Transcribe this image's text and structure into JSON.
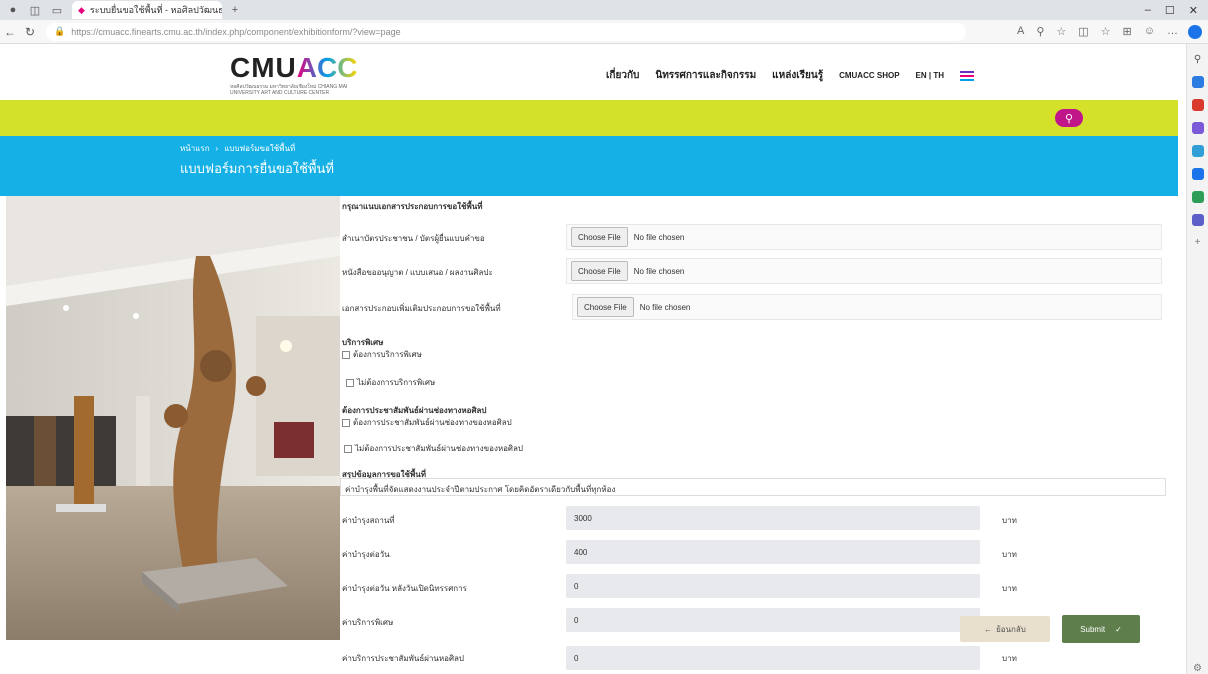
{
  "browser": {
    "tab_title": "ระบบยื่นขอใช้พื้นที่ - หอศิลปวัฒนธรรมฯ",
    "url": "https://cmuacc.finearts.cmu.ac.th/index.php/component/exhibitionform/?view=page",
    "win_min": "–",
    "win_max": "☐",
    "win_close": "✕"
  },
  "site": {
    "logo_main": "CMU",
    "logo_accent": "ACC",
    "logo_sub": "หอศิลปวัฒนธรรม มหาวิทยาลัยเชียงใหม่ CHIANG MAI UNIVERSITY ART AND CULTURE CENTER",
    "nav": [
      "เกี่ยวกับ",
      "นิทรรศการและกิจกรรม",
      "แหล่งเรียนรู้",
      "CMUACC SHOP",
      "EN | TH"
    ]
  },
  "breadcrumb": {
    "home": "หน้าแรก",
    "current": "แบบฟอร์มขอใช้พื้นที่"
  },
  "page_title": "แบบฟอร์มการยื่นขอใช้พื้นที่",
  "form": {
    "section_docs": "กรุณาแนบเอกสารประกอบการขอใช้พื้นที่",
    "file_rows": [
      {
        "label": "สำเนาบัตรประชาชน / บัตรผู้ยื่นแบบคำขอ",
        "button": "Choose File",
        "status": "No file chosen"
      },
      {
        "label": "หนังสือขออนุญาต / แบบเสนอ / ผลงานศิลปะ",
        "button": "Choose File",
        "status": "No file chosen"
      },
      {
        "label": "เอกสารประกอบเพิ่มเติมประกอบการขอใช้พื้นที่",
        "button": "Choose File",
        "status": "No file chosen"
      }
    ],
    "section_power": "บริการพิเศษ",
    "power_options": [
      "ต้องการบริการพิเศษ",
      "ไม่ต้องการบริการพิเศษ"
    ],
    "section_pr": "ต้องการประชาสัมพันธ์ผ่านช่องทางหอศิลป",
    "pr_options": [
      "ต้องการประชาสัมพันธ์ผ่านช่องทางของหอศิลป",
      "ไม่ต้องการประชาสัมพันธ์ผ่านช่องทางของหอศิลป"
    ],
    "section_summary": "สรุปข้อมูลการขอใช้พื้นที่",
    "summary_text": "ค่าบำรุงพื้นที่จัดแสดงงานประจำปีตามประกาศ โดยคิดอัตราเดียวกับพื้นที่ทุกห้อง",
    "fee_rows": [
      {
        "label": "ค่าบำรุงสถานที่",
        "value": "3000",
        "unit": "บาท"
      },
      {
        "label": "ค่าบำรุงต่อวัน",
        "value": "400",
        "unit": "บาท"
      },
      {
        "label": "ค่าบำรุงต่อวัน หลังวันเปิดนิทรรศการ",
        "value": "0",
        "unit": "บาท"
      },
      {
        "label": "ค่าบริการพิเศษ",
        "value": "0",
        "unit": ""
      },
      {
        "label": "ค่าบริการประชาสัมพันธ์ผ่านหอศิลป",
        "value": "0",
        "unit": "บาท"
      }
    ],
    "cancel_label": "ย้อนกลับ",
    "submit_label": "Submit"
  },
  "colors": {
    "lime": "#d4e12b",
    "cyan": "#15b1e6",
    "submit": "#5e7e4c",
    "search": "#c0168a"
  }
}
